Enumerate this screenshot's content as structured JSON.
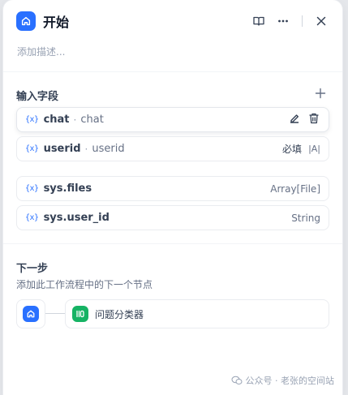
{
  "header": {
    "title": "开始",
    "description_placeholder": "添加描述..."
  },
  "input_fields": {
    "title": "输入字段",
    "items": [
      {
        "icon": "{x}",
        "name": "chat",
        "label": "chat"
      },
      {
        "icon": "{x}",
        "name": "userid",
        "label": "userid",
        "required": "必填",
        "type_marker": "|A|"
      }
    ]
  },
  "system_vars": [
    {
      "icon": "{x}",
      "name": "sys.files",
      "type": "Array[File]"
    },
    {
      "icon": "{x}",
      "name": "sys.user_id",
      "type": "String"
    }
  ],
  "next_step": {
    "title": "下一步",
    "description": "添加此工作流程中的下一个节点",
    "next_node_label": "问题分类器"
  },
  "watermark": {
    "text": "公众号 · 老张的空间站"
  },
  "colors": {
    "accent": "#2970ff",
    "classifier": "#16b364"
  }
}
